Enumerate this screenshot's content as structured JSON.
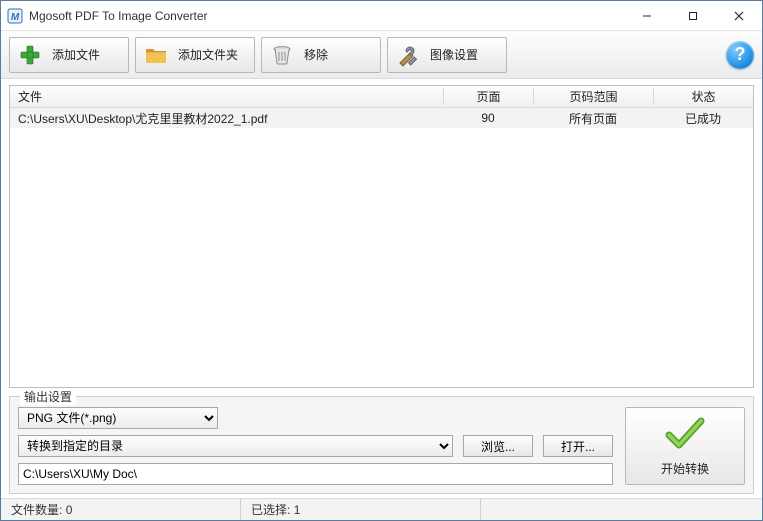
{
  "window": {
    "title": "Mgosoft PDF To Image Converter"
  },
  "toolbar": {
    "add_file": "添加文件",
    "add_folder": "添加文件夹",
    "remove": "移除",
    "image_settings": "图像设置",
    "help_symbol": "?"
  },
  "file_list": {
    "headers": {
      "file": "文件",
      "pages": "页面",
      "range": "页码范围",
      "status": "状态"
    },
    "rows": [
      {
        "file": "C:\\Users\\XU\\Desktop\\尤克里里教材2022_1.pdf",
        "pages": "90",
        "range": "所有页面",
        "status": "已成功"
      }
    ]
  },
  "output": {
    "legend": "输出设置",
    "format_option": "PNG 文件(*.png)",
    "dest_option": "转换到指定的目录",
    "browse": "浏览...",
    "open": "打开...",
    "path": "C:\\Users\\XU\\My Doc\\",
    "start": "开始转换"
  },
  "statusbar": {
    "file_count_label": "文件数量:",
    "file_count_value": "0",
    "selected_label": "已选择:",
    "selected_value": "1"
  }
}
